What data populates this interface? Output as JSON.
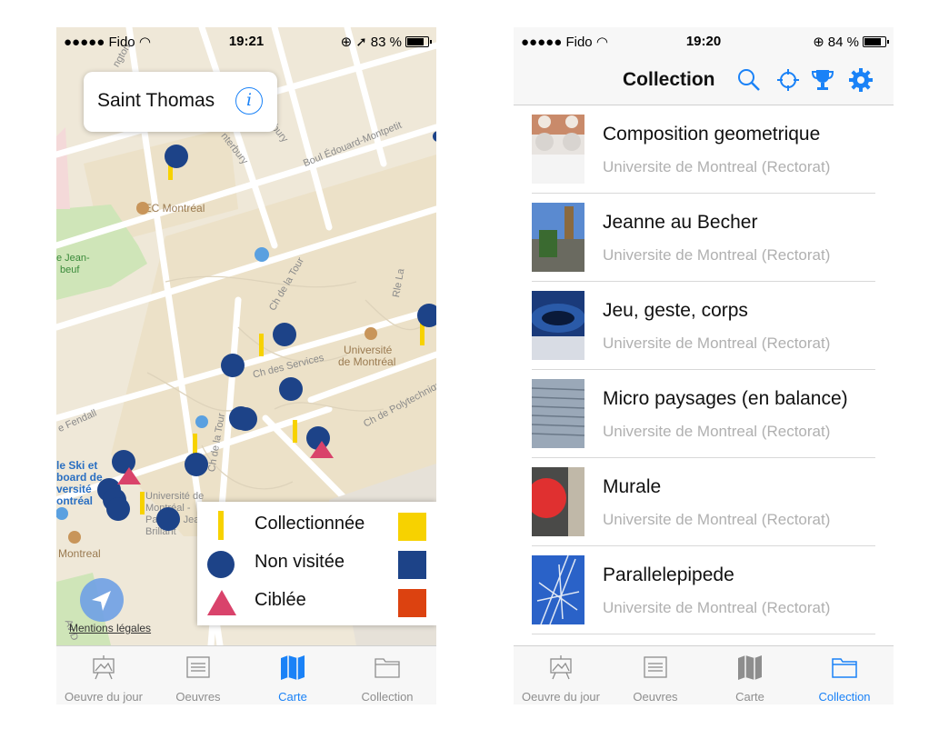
{
  "left": {
    "status": {
      "carrier": "●●●●● Fido",
      "time": "19:21",
      "battery": "83 %",
      "battery_level": 0.83
    },
    "callout": {
      "title": "Saint Thomas"
    },
    "map_labels": {
      "hec": "HEC Montréal",
      "udem": "Université",
      "udem2": "de Montréal",
      "boul": "Boul Édouard-Montpetit",
      "services": "Ch des Services",
      "tour1": "Ch de la Tour",
      "tour2": "Ch de la Tour",
      "poly": "Ch de Polytechnique",
      "fendall": "e Fendall",
      "jean1": "e Jean-",
      "jean2": "beuf",
      "canterbury": "nterbury",
      "ski1": "le Ski et",
      "ski2": "board de",
      "ski3": "versité",
      "ski4": "ontréal",
      "pav1": "Université de",
      "pav2": "Montréal -",
      "pav3": "Pavillon Jean-",
      "pav4": "Brillant",
      "montreal": "Montreal",
      "rle": "Rle La",
      "av": "Av D",
      "dbury": "dbury",
      "ington": "ngton"
    },
    "legend": [
      {
        "label": "Collectionnée",
        "color": "#f7d200"
      },
      {
        "label": "Non visitée",
        "color": "#1d4388"
      },
      {
        "label": "Ciblée",
        "color": "#dc4210"
      }
    ],
    "legal": "Mentions légales"
  },
  "right": {
    "status": {
      "carrier": "●●●●● Fido",
      "time": "19:20",
      "battery": "84 %",
      "battery_level": 0.84
    },
    "title": "Collection",
    "items": [
      {
        "title": "Composition geometrique",
        "subtitle": "Universite de Montreal (Rectorat)"
      },
      {
        "title": "Jeanne au Becher",
        "subtitle": "Universite de Montreal (Rectorat)"
      },
      {
        "title": "Jeu, geste, corps",
        "subtitle": "Universite de Montreal (Rectorat)"
      },
      {
        "title": "Micro paysages (en balance)",
        "subtitle": "Universite de Montreal (Rectorat)"
      },
      {
        "title": "Murale",
        "subtitle": "Universite de Montreal (Rectorat)"
      },
      {
        "title": "Parallelepipede",
        "subtitle": "Universite de Montreal (Rectorat)"
      }
    ]
  },
  "tabs": [
    {
      "label": "Oeuvre du jour",
      "icon": "easel-icon"
    },
    {
      "label": "Oeuvres",
      "icon": "list-icon"
    },
    {
      "label": "Carte",
      "icon": "map-icon"
    },
    {
      "label": "Collection",
      "icon": "folder-icon"
    }
  ],
  "colors": {
    "accent": "#1a82f7",
    "marker_blue": "#1d4388",
    "marker_yellow": "#f7d200",
    "marker_red": "#dc4210",
    "target_pink": "#d9436b"
  }
}
